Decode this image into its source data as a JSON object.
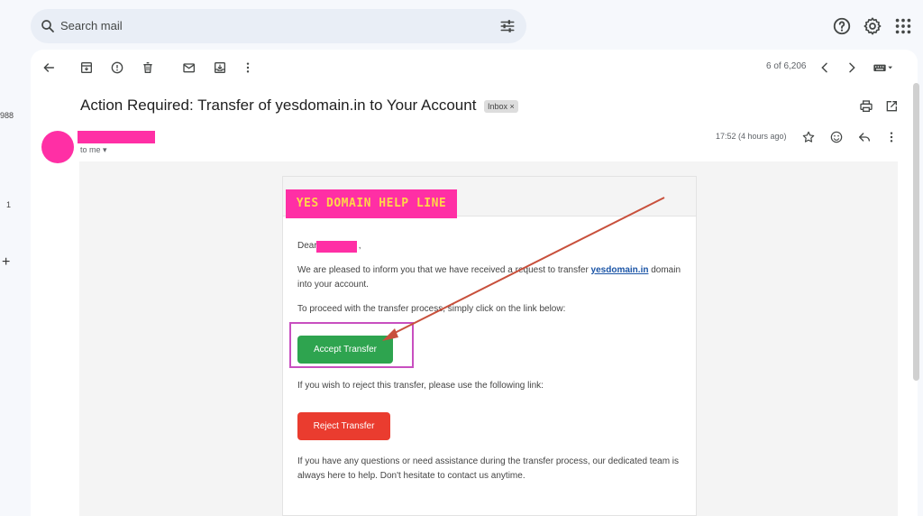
{
  "search": {
    "placeholder": "Search mail"
  },
  "left_rail": {
    "count_1": "988",
    "count_2": "1",
    "plus": "+"
  },
  "toolbar": {
    "pager": "6 of 6,206"
  },
  "email": {
    "subject": "Action Required: Transfer of yesdomain.in to Your Account",
    "label": "Inbox",
    "label_close": "×",
    "to": "to me",
    "timestamp": "17:52 (4 hours ago)"
  },
  "message": {
    "brand": "YES DOMAIN HELP LINE",
    "greeting": "Dear",
    "greeting_end": ",",
    "intro_before_link": "We are pleased to inform you that we have received a request to transfer ",
    "domain_link": "yesdomain.in",
    "intro_after_link": " domain into your account.",
    "proceed": "To proceed with the transfer process, simply click on the link below:",
    "accept_label": "Accept Transfer",
    "reject_prompt": "If you wish to reject this transfer, please use the following link:",
    "reject_label": "Reject Transfer",
    "closing": "If you have any questions or need assistance during the transfer process, our dedicated team is always here to help. Don't hesitate to contact us anytime."
  },
  "colors": {
    "accept": "#2ea44f",
    "reject": "#ea3c2f",
    "redaction": "#ff2fa5",
    "brand_text": "#ffd54a",
    "annotation": "#c84fc0",
    "arrow": "#c8503c"
  },
  "icons": {
    "search": "search-icon",
    "filter": "filter-icon",
    "help": "help-icon",
    "settings": "gear-icon",
    "apps": "apps-grid-icon",
    "back": "back-arrow-icon",
    "archive": "archive-icon",
    "report": "report-spam-icon",
    "delete": "delete-icon",
    "mark_unread": "mark-unread-icon",
    "move": "move-to-icon",
    "more": "more-vert-icon",
    "prev": "chevron-left-icon",
    "next": "chevron-right-icon",
    "keyboard": "keyboard-icon",
    "print": "print-icon",
    "open_new": "open-new-window-icon",
    "star": "star-icon",
    "emoji": "emoji-icon",
    "reply": "reply-icon"
  }
}
